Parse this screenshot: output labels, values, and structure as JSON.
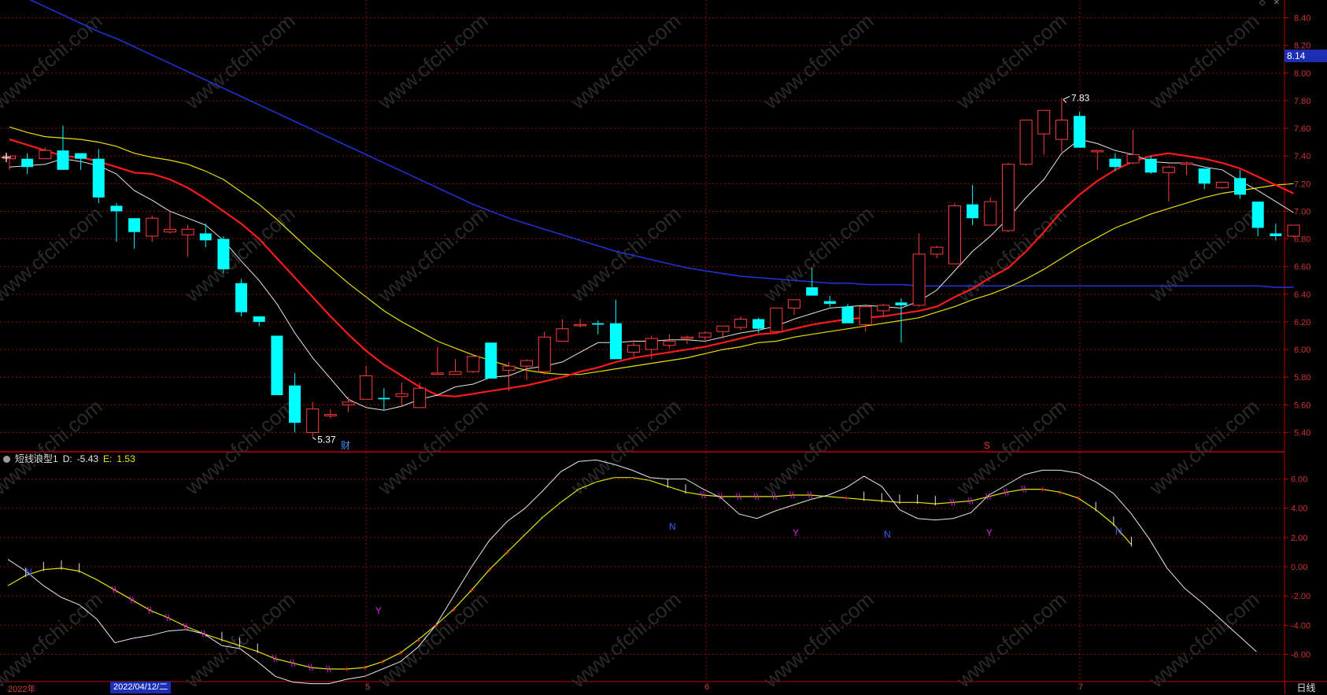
{
  "colors": {
    "grid": "#8a1111",
    "up": "#ff3c3c",
    "down": "#00ffff",
    "ma5": "#e6e6e6",
    "ma10": "#ff1a1a",
    "ma20": "#e8e000",
    "ma60": "#2233dd",
    "axis": "#c00000"
  },
  "price_axis": {
    "labels": [
      "8.40",
      "8.20",
      "8.00",
      "7.80",
      "7.60",
      "7.40",
      "7.20",
      "7.00",
      "6.80",
      "6.60",
      "6.40",
      "6.20",
      "6.00",
      "5.80",
      "5.60",
      "5.40"
    ],
    "current_price": "8.14"
  },
  "indicator": {
    "name": "短线浪型1",
    "d_label": "D:",
    "d_value": "-5.43",
    "e_label": "E:",
    "e_value": "1.53",
    "axis_labels": [
      "6.00",
      "4.00",
      "2.00",
      "0.00",
      "-2.00",
      "-4.00",
      "-6.00"
    ]
  },
  "dates": {
    "year_label": "2022年",
    "selected_date": "2022/04/12/二",
    "month_5": "5",
    "month_6": "6",
    "month_7": "7"
  },
  "period_label": "日线",
  "annotations": {
    "high": "7.83",
    "low": "5.37",
    "marker_cai": "财",
    "marker_s": "S"
  },
  "markers": {
    "y": "Y",
    "n": "N"
  },
  "watermark": "www.cfchi.com",
  "chart_data": {
    "type": "candlestick",
    "ylim_price": [
      5.3,
      8.5
    ],
    "ylim_indicator": [
      -7.0,
      7.0
    ],
    "candles": [
      [
        7.38,
        7.4,
        7.3,
        7.4
      ],
      [
        7.38,
        7.42,
        7.27,
        7.32
      ],
      [
        7.38,
        7.46,
        7.38,
        7.44
      ],
      [
        7.44,
        7.62,
        7.3,
        7.3
      ],
      [
        7.42,
        7.42,
        7.3,
        7.38
      ],
      [
        7.38,
        7.45,
        7.06,
        7.1
      ],
      [
        7.04,
        7.06,
        6.78,
        7.0
      ],
      [
        6.95,
        6.95,
        6.73,
        6.85
      ],
      [
        6.82,
        6.97,
        6.78,
        6.95
      ],
      [
        6.85,
        7.0,
        6.84,
        6.87
      ],
      [
        6.83,
        6.9,
        6.67,
        6.87
      ],
      [
        6.84,
        6.91,
        6.74,
        6.79
      ],
      [
        6.8,
        6.82,
        6.55,
        6.58
      ],
      [
        6.48,
        6.51,
        6.24,
        6.27
      ],
      [
        6.24,
        6.24,
        6.17,
        6.2
      ],
      [
        6.1,
        6.1,
        5.67,
        5.67
      ],
      [
        5.74,
        5.83,
        5.4,
        5.47
      ],
      [
        5.4,
        5.62,
        5.37,
        5.57
      ],
      [
        5.52,
        5.57,
        5.5,
        5.53
      ],
      [
        5.6,
        5.66,
        5.55,
        5.62
      ],
      [
        5.64,
        5.88,
        5.64,
        5.81
      ],
      [
        5.65,
        5.72,
        5.56,
        5.64
      ],
      [
        5.66,
        5.76,
        5.59,
        5.68
      ],
      [
        5.58,
        5.76,
        5.58,
        5.72
      ],
      [
        5.82,
        6.02,
        5.82,
        5.83
      ],
      [
        5.82,
        5.93,
        5.82,
        5.84
      ],
      [
        5.84,
        5.96,
        5.83,
        5.95
      ],
      [
        6.05,
        6.05,
        5.8,
        5.79
      ],
      [
        5.85,
        5.91,
        5.7,
        5.88
      ],
      [
        5.88,
        5.93,
        5.78,
        5.92
      ],
      [
        5.84,
        6.13,
        5.82,
        6.09
      ],
      [
        6.06,
        6.22,
        6.06,
        6.15
      ],
      [
        6.18,
        6.22,
        6.16,
        6.18
      ],
      [
        6.19,
        6.21,
        6.11,
        6.18
      ],
      [
        6.19,
        6.36,
        5.93,
        5.93
      ],
      [
        5.98,
        6.07,
        5.95,
        6.03
      ],
      [
        6.0,
        6.1,
        5.93,
        6.08
      ],
      [
        6.03,
        6.11,
        6.01,
        6.06
      ],
      [
        6.08,
        6.1,
        6.04,
        6.09
      ],
      [
        6.09,
        6.13,
        6.07,
        6.12
      ],
      [
        6.13,
        6.17,
        6.08,
        6.17
      ],
      [
        6.16,
        6.24,
        6.14,
        6.22
      ],
      [
        6.22,
        6.23,
        6.12,
        6.15
      ],
      [
        6.13,
        6.3,
        6.13,
        6.3
      ],
      [
        6.3,
        6.36,
        6.25,
        6.36
      ],
      [
        6.45,
        6.59,
        6.4,
        6.39
      ],
      [
        6.35,
        6.39,
        6.31,
        6.33
      ],
      [
        6.31,
        6.33,
        6.19,
        6.19
      ],
      [
        6.18,
        6.32,
        6.13,
        6.31
      ],
      [
        6.28,
        6.33,
        6.24,
        6.32
      ],
      [
        6.34,
        6.37,
        6.05,
        6.32
      ],
      [
        6.32,
        6.84,
        6.31,
        6.69
      ],
      [
        6.69,
        6.75,
        6.66,
        6.74
      ],
      [
        6.62,
        7.06,
        6.62,
        7.04
      ],
      [
        7.05,
        7.19,
        6.9,
        6.95
      ],
      [
        6.9,
        7.1,
        6.91,
        7.07
      ],
      [
        6.86,
        7.35,
        6.85,
        7.34
      ],
      [
        7.34,
        7.65,
        7.33,
        7.66
      ],
      [
        7.56,
        7.72,
        7.41,
        7.73
      ],
      [
        7.52,
        7.82,
        7.43,
        7.66
      ],
      [
        7.69,
        7.72,
        7.46,
        7.46
      ],
      [
        7.43,
        7.44,
        7.3,
        7.44
      ],
      [
        7.38,
        7.42,
        7.29,
        7.32
      ],
      [
        7.35,
        7.59,
        7.34,
        7.41
      ],
      [
        7.38,
        7.4,
        7.27,
        7.28
      ],
      [
        7.28,
        7.33,
        7.07,
        7.32
      ],
      [
        7.34,
        7.36,
        7.26,
        7.35
      ],
      [
        7.31,
        7.31,
        7.16,
        7.2
      ],
      [
        7.17,
        7.21,
        7.16,
        7.21
      ],
      [
        7.24,
        7.3,
        7.09,
        7.12
      ],
      [
        7.07,
        7.07,
        6.82,
        6.88
      ],
      [
        6.84,
        6.91,
        6.79,
        6.82
      ],
      [
        6.82,
        6.9,
        6.81,
        6.9
      ]
    ],
    "ma5": [
      7.32,
      7.33,
      7.34,
      7.38,
      7.36,
      7.33,
      7.27,
      7.15,
      7.08,
      7.0,
      6.95,
      6.9,
      6.79,
      6.64,
      6.5,
      6.33,
      6.12,
      5.94,
      5.79,
      5.64,
      5.58,
      5.56,
      5.59,
      5.64,
      5.67,
      5.73,
      5.75,
      5.8,
      5.81,
      5.86,
      5.88,
      5.91,
      5.98,
      6.05,
      6.05,
      6.06,
      6.06,
      6.07,
      6.07,
      6.06,
      6.09,
      6.12,
      6.14,
      6.17,
      6.22,
      6.26,
      6.3,
      6.31,
      6.32,
      6.31,
      6.3,
      6.35,
      6.43,
      6.57,
      6.71,
      6.82,
      6.95,
      7.1,
      7.23,
      7.42,
      7.52,
      7.49,
      7.44,
      7.41,
      7.36,
      7.35,
      7.35,
      7.32,
      7.3,
      7.22,
      7.15,
      7.07,
      6.99
    ],
    "ma10": [
      7.52,
      7.48,
      7.44,
      7.4,
      7.39,
      7.36,
      7.32,
      7.28,
      7.27,
      7.23,
      7.17,
      7.09,
      7.0,
      6.91,
      6.8,
      6.66,
      6.52,
      6.38,
      6.24,
      6.11,
      5.99,
      5.89,
      5.81,
      5.73,
      5.67,
      5.66,
      5.68,
      5.7,
      5.72,
      5.74,
      5.77,
      5.8,
      5.84,
      5.87,
      5.91,
      5.94,
      5.96,
      5.98,
      6.0,
      6.02,
      6.05,
      6.08,
      6.11,
      6.12,
      6.15,
      6.18,
      6.2,
      6.22,
      6.23,
      6.24,
      6.26,
      6.28,
      6.31,
      6.38,
      6.44,
      6.52,
      6.59,
      6.71,
      6.85,
      7.0,
      7.12,
      7.22,
      7.3,
      7.36,
      7.4,
      7.42,
      7.4,
      7.38,
      7.35,
      7.31,
      7.25,
      7.19,
      7.13
    ],
    "ma20": [
      7.61,
      7.57,
      7.54,
      7.53,
      7.52,
      7.5,
      7.47,
      7.42,
      7.39,
      7.37,
      7.34,
      7.29,
      7.23,
      7.14,
      7.05,
      6.94,
      6.82,
      6.7,
      6.59,
      6.48,
      6.38,
      6.28,
      6.2,
      6.13,
      6.06,
      6.01,
      5.96,
      5.92,
      5.88,
      5.85,
      5.83,
      5.82,
      5.82,
      5.84,
      5.86,
      5.88,
      5.9,
      5.92,
      5.94,
      5.97,
      6.0,
      6.02,
      6.05,
      6.06,
      6.09,
      6.11,
      6.13,
      6.15,
      6.17,
      6.19,
      6.21,
      6.23,
      6.27,
      6.31,
      6.36,
      6.4,
      6.45,
      6.51,
      6.58,
      6.66,
      6.74,
      6.81,
      6.88,
      6.93,
      6.98,
      7.02,
      7.06,
      7.1,
      7.13,
      7.15,
      7.17,
      7.19,
      7.2
    ],
    "ma60": [
      8.6,
      8.54,
      8.48,
      8.42,
      8.36,
      8.3,
      8.25,
      8.19,
      8.13,
      8.07,
      8.01,
      7.95,
      7.89,
      7.83,
      7.77,
      7.71,
      7.65,
      7.59,
      7.53,
      7.47,
      7.41,
      7.35,
      7.29,
      7.23,
      7.17,
      7.11,
      7.05,
      7.0,
      6.95,
      6.91,
      6.87,
      6.83,
      6.79,
      6.75,
      6.71,
      6.68,
      6.65,
      6.62,
      6.59,
      6.57,
      6.55,
      6.53,
      6.52,
      6.51,
      6.5,
      6.49,
      6.48,
      6.48,
      6.47,
      6.47,
      6.47,
      6.46,
      6.46,
      6.46,
      6.46,
      6.46,
      6.46,
      6.46,
      6.46,
      6.46,
      6.46,
      6.46,
      6.46,
      6.46,
      6.46,
      6.46,
      6.46,
      6.46,
      6.46,
      6.46,
      6.46,
      6.45,
      6.45
    ],
    "indicator_D": [
      0.5,
      -0.3,
      -1.3,
      -2.1,
      -2.6,
      -3.6,
      -5.2,
      -4.9,
      -4.7,
      -4.4,
      -4.3,
      -4.6,
      -5.4,
      -5.6,
      -6.5,
      -7.5,
      -7.9,
      -8.0,
      -8.0,
      -7.7,
      -7.5,
      -7.0,
      -6.5,
      -5.5,
      -4.0,
      -2.0,
      0.0,
      1.8,
      3.1,
      4.0,
      5.2,
      6.5,
      7.2,
      7.3,
      7.0,
      6.6,
      6.1,
      6.0,
      6.0,
      5.3,
      4.7,
      3.6,
      3.3,
      3.8,
      4.2,
      4.6,
      4.9,
      5.4,
      6.2,
      5.5,
      3.9,
      3.3,
      3.2,
      3.3,
      3.7,
      4.9,
      5.6,
      6.3,
      6.6,
      6.6,
      6.4,
      5.8,
      5.0,
      3.6,
      1.9,
      -0.1,
      -1.5,
      -2.5,
      -3.6,
      -4.7,
      -5.8
    ],
    "indicator_E": [
      -1.3,
      -0.6,
      -0.2,
      -0.1,
      -0.3,
      -0.9,
      -1.6,
      -2.3,
      -3.0,
      -3.5,
      -4.1,
      -4.6,
      -5.0,
      -5.4,
      -5.8,
      -6.3,
      -6.6,
      -6.9,
      -7.0,
      -7.0,
      -6.9,
      -6.5,
      -5.9,
      -5.0,
      -4.0,
      -2.9,
      -1.6,
      -0.2,
      1.0,
      2.2,
      3.4,
      4.4,
      5.3,
      5.8,
      6.1,
      6.1,
      5.9,
      5.5,
      5.1,
      4.9,
      4.8,
      4.8,
      4.8,
      4.8,
      4.9,
      4.9,
      4.8,
      4.7,
      4.6,
      4.5,
      4.4,
      4.4,
      4.3,
      4.4,
      4.5,
      4.8,
      5.1,
      5.3,
      5.3,
      5.1,
      4.7,
      3.9,
      2.9,
      1.5
    ],
    "marker_kinds": [
      "B",
      "I",
      "I",
      "I",
      "I",
      "B",
      "M",
      "M",
      "M",
      "M",
      "M",
      "M",
      "I",
      "I",
      "I",
      "M",
      "M",
      "M",
      "M",
      "P",
      "P",
      "P",
      "P",
      "P",
      "P",
      "P",
      "P",
      "P",
      "P",
      "G",
      "G",
      "G",
      "G",
      "G",
      "G",
      "G",
      "G",
      "I",
      "I",
      "M",
      "M",
      "M",
      "M",
      "M",
      "M",
      "M",
      "G",
      "P",
      "I",
      "I",
      "I",
      "I",
      "I",
      "M",
      "M",
      "M",
      "M",
      "M",
      "P",
      "P",
      "P",
      "I",
      "I",
      "I",
      "I",
      "I",
      "I",
      "I",
      "I",
      "I",
      "I",
      "I",
      "I"
    ],
    "price_xlabels": {
      "high_index": 59,
      "low_index": 17
    }
  }
}
